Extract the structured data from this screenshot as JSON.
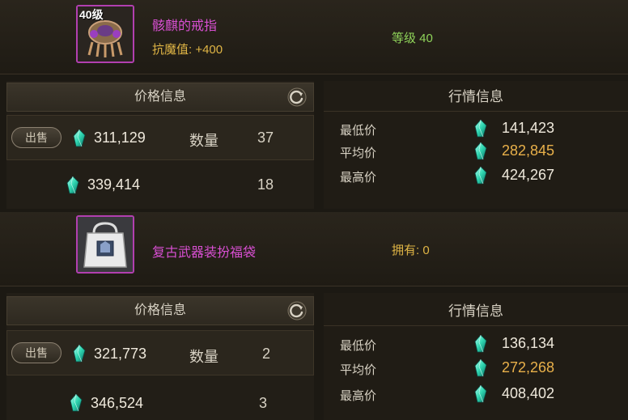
{
  "items": [
    {
      "icon": "ring-icon",
      "level_badge": "40级",
      "name": "骸麒的戒指",
      "stat": "抗魔值: +400",
      "level": "等级 40",
      "price_panel": {
        "title": "价格信息",
        "sell_label": "出售",
        "sell_price": "311,129",
        "qty_label": "数量",
        "qty": "37",
        "second_price": "339,414",
        "second_qty": "18"
      },
      "market": {
        "title": "行情信息",
        "min_label": "最低价",
        "min_value": "141,423",
        "avg_label": "平均价",
        "avg_value": "282,845",
        "max_label": "最高价",
        "max_value": "424,267"
      }
    },
    {
      "icon": "bag-icon",
      "name": "复古武器装扮福袋",
      "owned": "拥有: 0",
      "price_panel": {
        "title": "价格信息",
        "sell_label": "出售",
        "sell_price": "321,773",
        "qty_label": "数量",
        "qty": "2",
        "second_price": "346,524",
        "second_qty": "3"
      },
      "market": {
        "title": "行情信息",
        "min_label": "最低价",
        "min_value": "136,134",
        "avg_label": "平均价",
        "avg_value": "272,268",
        "max_label": "最高价",
        "max_value": "408,402"
      }
    }
  ],
  "colors": {
    "item_name": "#d84fd2",
    "stat": "#e0b545",
    "level": "#8fd35a",
    "avg_price": "#e8b04a",
    "gem": "#2fd6b0"
  }
}
